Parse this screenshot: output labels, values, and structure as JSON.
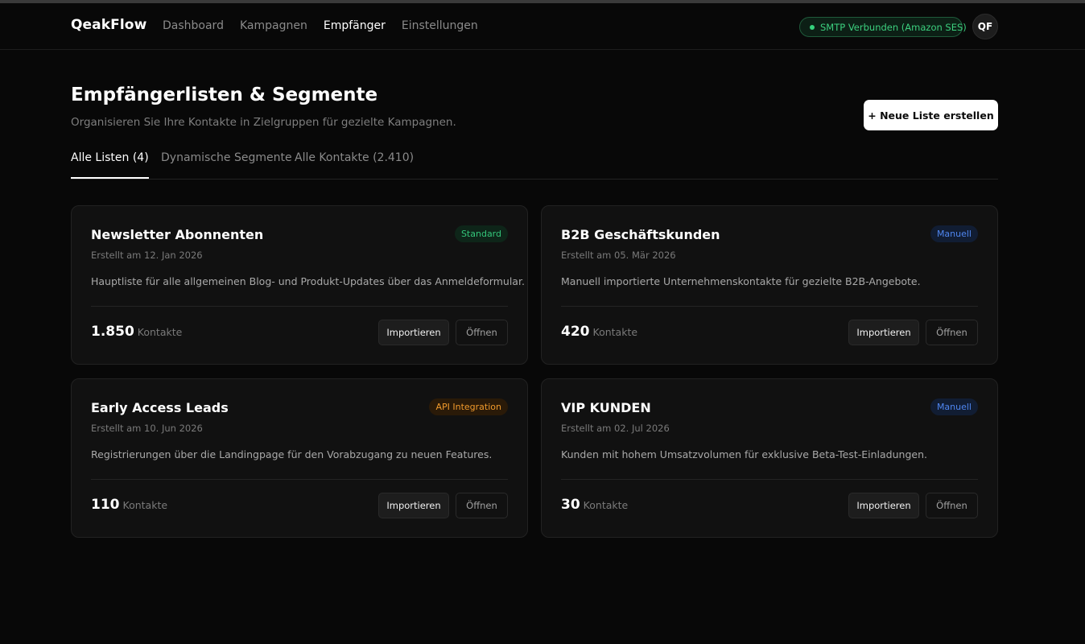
{
  "header": {
    "brand": "QeakFlow",
    "nav": [
      "Dashboard",
      "Kampagnen",
      "Empfänger",
      "Einstellungen"
    ],
    "active_nav": "Empfänger",
    "smtp_status": "SMTP Verbunden (Amazon SES)",
    "avatar_initials": "QF"
  },
  "page": {
    "title": "Empfängerlisten & Segmente",
    "subtitle": "Organisieren Sie Ihre Kontakte in Zielgruppen für gezielte Kampagnen.",
    "new_button": "+ Neue Liste erstellen"
  },
  "tabs": [
    "Alle Listen (4)",
    "Dynamische Segmente",
    "Alle Kontakte (2.410)"
  ],
  "lists": [
    {
      "title": "Newsletter Abonnenten",
      "badge": "Standard",
      "badge_color": "#34c57a",
      "created": "Erstellt am 12. Jan 2026",
      "description": "Hauptliste für alle allgemeinen Blog- und Produkt-Updates über das Anmeldeformular.",
      "count": "1.850",
      "count_label": "Kontakte",
      "import_label": "Importieren",
      "open_label": "Öffnen"
    },
    {
      "title": "B2B Geschäftskunden",
      "badge": "Manuell",
      "badge_color": "#4f86f0",
      "created": "Erstellt am 05. Mär 2026",
      "description": "Manuell importierte Unternehmenskontakte für gezielte B2B-Angebote.",
      "count": "420",
      "count_label": "Kontakte",
      "import_label": "Importieren",
      "open_label": "Öffnen"
    },
    {
      "title": "Early Access Leads",
      "badge": "API Integration",
      "badge_color": "#f09a2c",
      "created": "Erstellt am 10. Jun 2026",
      "description": "Registrierungen über die Landingpage für den Vorabzugang zu neuen Features.",
      "count": "110",
      "count_label": "Kontakte",
      "import_label": "Importieren",
      "open_label": "Öffnen"
    },
    {
      "title": "VIP KUNDEN",
      "badge": "Manuell",
      "badge_color": "#4f86f0",
      "created": "Erstellt am 02. Jul 2026",
      "description": "Kunden mit hohem Umsatzvolumen für exklusive Beta-Test-Einladungen.",
      "count": "30",
      "count_label": "Kontakte",
      "import_label": "Importieren",
      "open_label": "Öffnen"
    }
  ]
}
